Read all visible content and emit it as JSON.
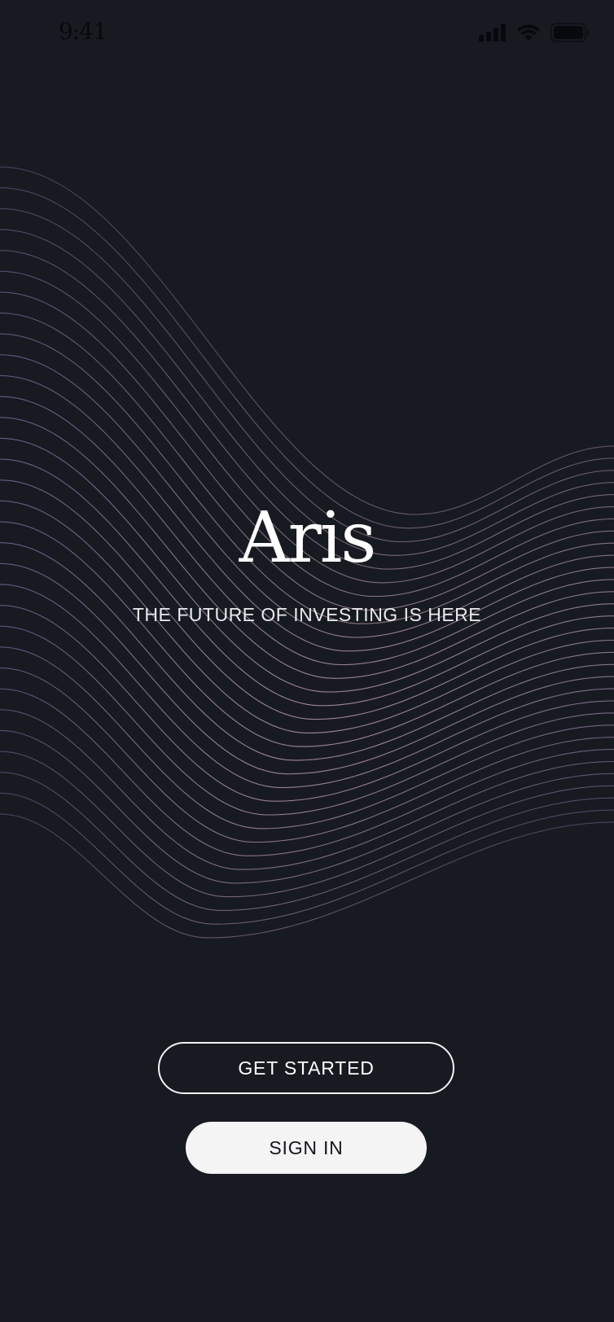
{
  "status_bar": {
    "time": "9:41",
    "icons": [
      "signal-icon",
      "wifi-icon",
      "battery-icon"
    ]
  },
  "brand": {
    "name": "Aris",
    "tagline": "THE FUTURE OF INVESTING IS HERE"
  },
  "actions": {
    "get_started_label": "GET STARTED",
    "sign_in_label": "SIGN IN"
  },
  "colors": {
    "background": "#181a22",
    "wave_top": "#6f6d95",
    "wave_bottom": "#b59aa5",
    "button_outline": "#f2f2f4",
    "button_fill": "#f4f4f5"
  }
}
